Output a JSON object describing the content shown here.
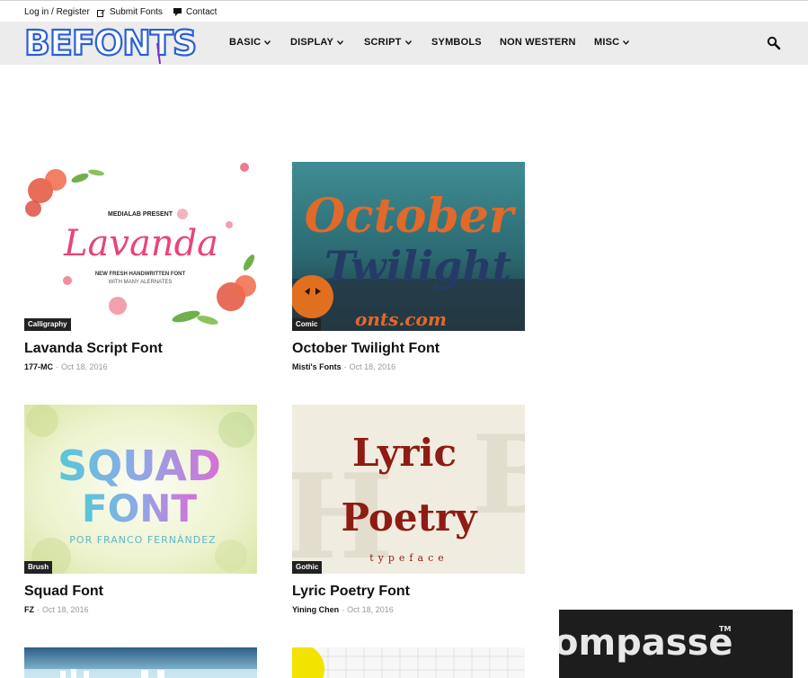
{
  "top_links": {
    "login": "Log in / Register",
    "submit": "Submit Fonts",
    "contact": "Contact"
  },
  "logo": {
    "text": "BEFONTS"
  },
  "nav": [
    {
      "label": "BASIC",
      "has_dropdown": true
    },
    {
      "label": "DISPLAY",
      "has_dropdown": true
    },
    {
      "label": "SCRIPT",
      "has_dropdown": true
    },
    {
      "label": "SYMBOLS",
      "has_dropdown": false
    },
    {
      "label": "NON WESTERN",
      "has_dropdown": false
    },
    {
      "label": "MISC",
      "has_dropdown": true
    }
  ],
  "posts": [
    {
      "title": "Lavanda Script Font",
      "category": "Calligraphy",
      "author": "177-MC",
      "date": "Oct 18, 2016",
      "preview": {
        "overline": "MEDIALAB PRESENT",
        "word": "Lavanda",
        "line1": "NEW FRESH HANDWRITTEN FONT",
        "line2": "WITH MANY ALERNATES"
      }
    },
    {
      "title": "October Twilight Font",
      "category": "Comic",
      "author": "Misti's Fonts",
      "date": "Oct 18, 2016",
      "preview": {
        "word1": "October",
        "word2": "Twilight",
        "footer": "onts.com"
      }
    },
    {
      "title": "Squad Font",
      "category": "Brush",
      "author": "FZ",
      "date": "Oct 18, 2016",
      "preview": {
        "word1": "SQUAD",
        "word2": "FONT",
        "byline": "POR FRANCO FERNÁNDEZ"
      }
    },
    {
      "title": "Lyric Poetry Font",
      "category": "Gothic",
      "author": "Yining Chen",
      "date": "Oct 18, 2016",
      "preview": {
        "word1": "Lyric",
        "word2": "Poetry",
        "tag": "typeface"
      }
    }
  ],
  "ad": {
    "text": "ompasse",
    "mark": "TM"
  },
  "colors": {
    "nav_bg": "#ececec",
    "badge_bg": "#222222",
    "logo_blue": "#2b5fd6",
    "logo_purple": "#7a2fd0"
  },
  "icons": [
    "edit-icon",
    "comment-icon",
    "search-icon",
    "chevron-down-icon"
  ]
}
